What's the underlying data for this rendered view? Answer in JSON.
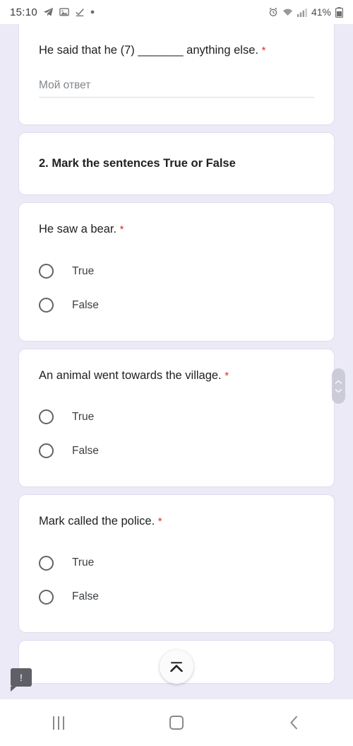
{
  "status_bar": {
    "time": "15:10",
    "left_icons": [
      "telegram-icon",
      "gallery-icon",
      "check-graph-icon",
      "dot-icon"
    ],
    "right_icons": [
      "alarm-icon",
      "wifi-icon",
      "signal-icon"
    ],
    "battery_percent": "41%"
  },
  "form": {
    "cards": [
      {
        "type": "short-answer",
        "question": "He said that he (7) _______ anything else.",
        "required_marker": "*",
        "answer_placeholder": "Мой ответ"
      },
      {
        "type": "section-header",
        "question": "2. Mark the sentences True or False"
      },
      {
        "type": "radio",
        "question": "He saw a bear.",
        "required_marker": "*",
        "options": [
          "True",
          "False"
        ],
        "selected": null
      },
      {
        "type": "radio",
        "question": "An animal went towards the village.",
        "required_marker": "*",
        "options": [
          "True",
          "False"
        ],
        "selected": null
      },
      {
        "type": "radio",
        "question": "Mark called the police.",
        "required_marker": "*",
        "options": [
          "True",
          "False"
        ],
        "selected": null
      }
    ]
  },
  "overlays": {
    "scroll_to_top_icon": "collapse-up-icon",
    "scrollbar_icon": "scroll-thumb-icon",
    "warning_badge_icon": "warning-bubble-icon",
    "warning_badge_text": "!"
  },
  "nav_bar": {
    "recents_icon": "recents-icon",
    "home_icon": "home-icon",
    "back_icon": "back-icon"
  },
  "colors": {
    "background": "#ebeaf6",
    "card": "#ffffff",
    "required_asterisk": "#d93025",
    "text_primary": "#202124",
    "text_secondary": "#3c4043",
    "placeholder": "#80868b",
    "radio_border": "#5f6368"
  }
}
